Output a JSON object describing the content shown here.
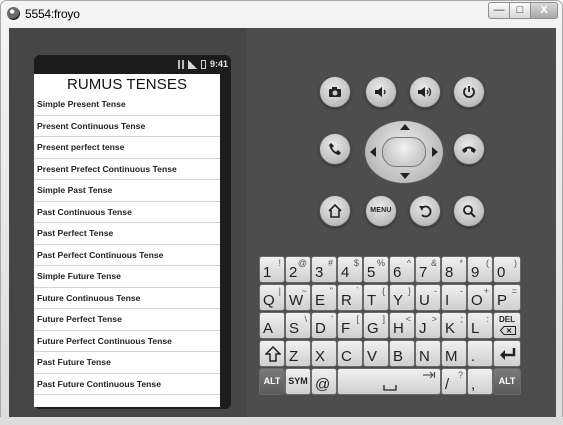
{
  "window": {
    "title": "5554:froyo",
    "min_label": "—",
    "max_label": "□",
    "close_label": "X"
  },
  "phone": {
    "clock": "9:41",
    "app_title": "RUMUS TENSES",
    "list_items": [
      "Simple Present Tense",
      "Present Continuous Tense",
      "Present perfect tense",
      "Present Prefect Continuous Tense",
      "Simple Past Tense",
      "Past Continuous Tense",
      "Past Perfect Tense",
      "Past Perfect Continuous Tense",
      "Simple Future Tense",
      "Future Continuous Tense",
      "Future Perfect Tense",
      "Future Perfect Continuous Tense",
      "Past Future Tense",
      "Past Future Continuous Tense"
    ]
  },
  "controls": {
    "camera": "camera-icon",
    "vol_down": "volume-down-icon",
    "vol_up": "volume-up-icon",
    "power": "power-icon",
    "call": "call-icon",
    "end_call": "end-call-icon",
    "home": "home-icon",
    "menu_label": "MENU",
    "back": "back-icon",
    "search": "search-icon"
  },
  "keyboard": {
    "row1": [
      {
        "m": "1",
        "a": "!"
      },
      {
        "m": "2",
        "a": "@"
      },
      {
        "m": "3",
        "a": "#"
      },
      {
        "m": "4",
        "a": "$"
      },
      {
        "m": "5",
        "a": "%"
      },
      {
        "m": "6",
        "a": "^"
      },
      {
        "m": "7",
        "a": "&"
      },
      {
        "m": "8",
        "a": "*"
      },
      {
        "m": "9",
        "a": "("
      },
      {
        "m": "0",
        "a": ")"
      }
    ],
    "row2": [
      {
        "m": "Q",
        "a": "|"
      },
      {
        "m": "W",
        "a": "~"
      },
      {
        "m": "E",
        "a": "\""
      },
      {
        "m": "R",
        "a": "`"
      },
      {
        "m": "T",
        "a": "{"
      },
      {
        "m": "Y",
        "a": "}"
      },
      {
        "m": "U",
        "a": "-"
      },
      {
        "m": "I",
        "a": "-"
      },
      {
        "m": "O",
        "a": "+"
      },
      {
        "m": "P",
        "a": "="
      }
    ],
    "row3": [
      {
        "m": "A",
        "a": ""
      },
      {
        "m": "S",
        "a": "\\"
      },
      {
        "m": "D",
        "a": "'"
      },
      {
        "m": "F",
        "a": "["
      },
      {
        "m": "G",
        "a": "]"
      },
      {
        "m": "H",
        "a": "<"
      },
      {
        "m": "J",
        "a": ">"
      },
      {
        "m": "K",
        "a": ";"
      },
      {
        "m": "L",
        "a": ":"
      }
    ],
    "del_label": "DEL",
    "row4": [
      {
        "m": "Z",
        "a": ""
      },
      {
        "m": "X",
        "a": ""
      },
      {
        "m": "C",
        "a": ""
      },
      {
        "m": "V",
        "a": ""
      },
      {
        "m": "B",
        "a": ""
      },
      {
        "m": "N",
        "a": ""
      },
      {
        "m": "M",
        "a": ""
      },
      {
        "m": ".",
        "a": ""
      }
    ],
    "alt_label": "ALT",
    "sym_label": "SYM",
    "at_label": "@",
    "slash_label": "/",
    "slash_alt": "?",
    "comma_label": ","
  }
}
